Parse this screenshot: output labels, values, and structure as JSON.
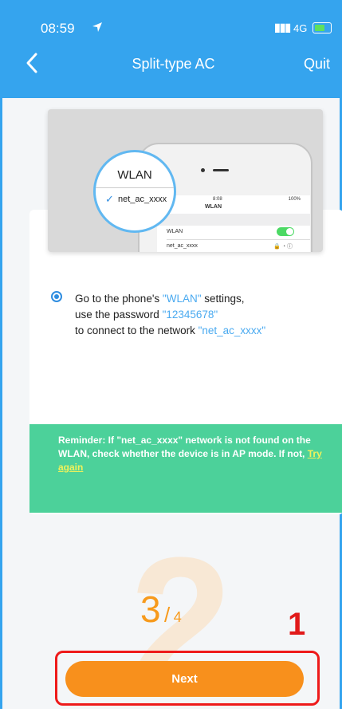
{
  "status_bar": {
    "time": "08:59",
    "network": "4G"
  },
  "nav": {
    "title": "Split-type AC",
    "quit_label": "Quit"
  },
  "illustration": {
    "magnifier_title": "WLAN",
    "magnifier_item": "net_ac_xxxx",
    "screen_time": "8:08",
    "screen_battery": "100%",
    "screen_title": "WLAN",
    "screen_row_wlan": "WLAN",
    "screen_row_network": "net_ac_xxxx"
  },
  "instruction": {
    "line1_prefix": "Go to the phone's ",
    "line1_highlight": "\"WLAN\"",
    "line1_suffix": " settings,",
    "line2_prefix": "use the password ",
    "line2_highlight": "\"12345678\"",
    "line3_prefix": "to connect to the network ",
    "line3_highlight": "\"net_ac_xxxx\""
  },
  "reminder": {
    "text": "Reminder: If \"net_ac_xxxx\" network is not found on the WLAN, check whether the device is in AP mode. If not, ",
    "link": "Try again"
  },
  "progress": {
    "current": "3",
    "separator": "/",
    "total": "4"
  },
  "footer": {
    "next_label": "Next"
  },
  "annotation": {
    "number": "1"
  },
  "colors": {
    "primary_blue": "#35a4ee",
    "highlight_blue": "#4aaaf0",
    "reminder_green": "#4cd19a",
    "next_orange": "#f8901c",
    "annotation_red": "#ee1a1a"
  }
}
